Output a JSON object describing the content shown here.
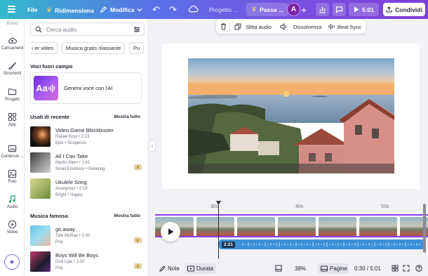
{
  "topbar": {
    "file": "File",
    "resize": "Ridimensiona",
    "edit": "Modifica",
    "project": "Progetto ...",
    "pro": "Passa ...",
    "avatar": "A",
    "timer": "5:01",
    "share": "Condividi",
    "icons": [
      "menu-icon",
      "crown-icon",
      "pencil-icon",
      "chevron-down-icon",
      "undo-icon",
      "redo-icon",
      "cloud-sync-icon",
      "plus-icon",
      "chart-icon",
      "comment-icon",
      "play-icon",
      "upload-icon"
    ]
  },
  "rail": {
    "brand": "Brand",
    "items": [
      {
        "label": "Caricamenti",
        "icon": "upload-cloud-icon"
      },
      {
        "label": "Strumenti",
        "icon": "brush-icon"
      },
      {
        "label": "Progetti",
        "icon": "folder-icon"
      },
      {
        "label": "App",
        "icon": "apps-icon"
      },
      {
        "label": "Contenuti ...",
        "icon": "image-icon"
      },
      {
        "label": "Foto",
        "icon": "photo-icon"
      },
      {
        "label": "Audio",
        "icon": "music-icon"
      },
      {
        "label": "Video",
        "icon": "video-icon"
      }
    ],
    "magic_icon": "sparkle-icon"
  },
  "panel": {
    "search_placeholder": "Cerca audio",
    "chips": [
      "er video",
      "Musica gratis rilassante",
      "Pu"
    ],
    "voices_title": "Voci fuori campo",
    "ai_thumb": "Aa",
    "ai_label": "Genera voce con l'AI",
    "recent_title": "Usati di recente",
    "recent_more": "Mostra tutto",
    "recent": [
      {
        "title": "Video Game Blockbuster",
        "meta1": "Rafael Krux • 2:23",
        "meta2": "Epic • Suspense",
        "premium": false
      },
      {
        "title": "All I Can Take",
        "meta1": "Martin Klem • 1:41",
        "meta2": "Small Emotions • Relaxing",
        "premium": true
      },
      {
        "title": "Ukulele Song",
        "meta1": "Anonymus • 2:19",
        "meta2": "Bright • Happy",
        "premium": false
      }
    ],
    "famous_title": "Musica famosa",
    "famous_more": "Mostra tutto",
    "famous": [
      {
        "title": "go away",
        "meta1": "Tate McRae • 1:00",
        "meta2": "Pop",
        "premium": true
      },
      {
        "title": "Boys Will Be Boys",
        "meta1": "Dua Lipa • 1:00",
        "meta2": "Pop",
        "premium": true
      }
    ]
  },
  "context_toolbar": {
    "split": "Slitta audio",
    "dissolve": "Dissolvenza",
    "beat": "Beat Sync"
  },
  "timeline": {
    "ticks": [
      "30s",
      "40s",
      "50s"
    ],
    "audio_time": "2:21"
  },
  "bottombar": {
    "notes": "Note",
    "duration": "Durata",
    "zoom": "38%",
    "pages": "Pagine",
    "time": "0:30 / 5:01"
  }
}
